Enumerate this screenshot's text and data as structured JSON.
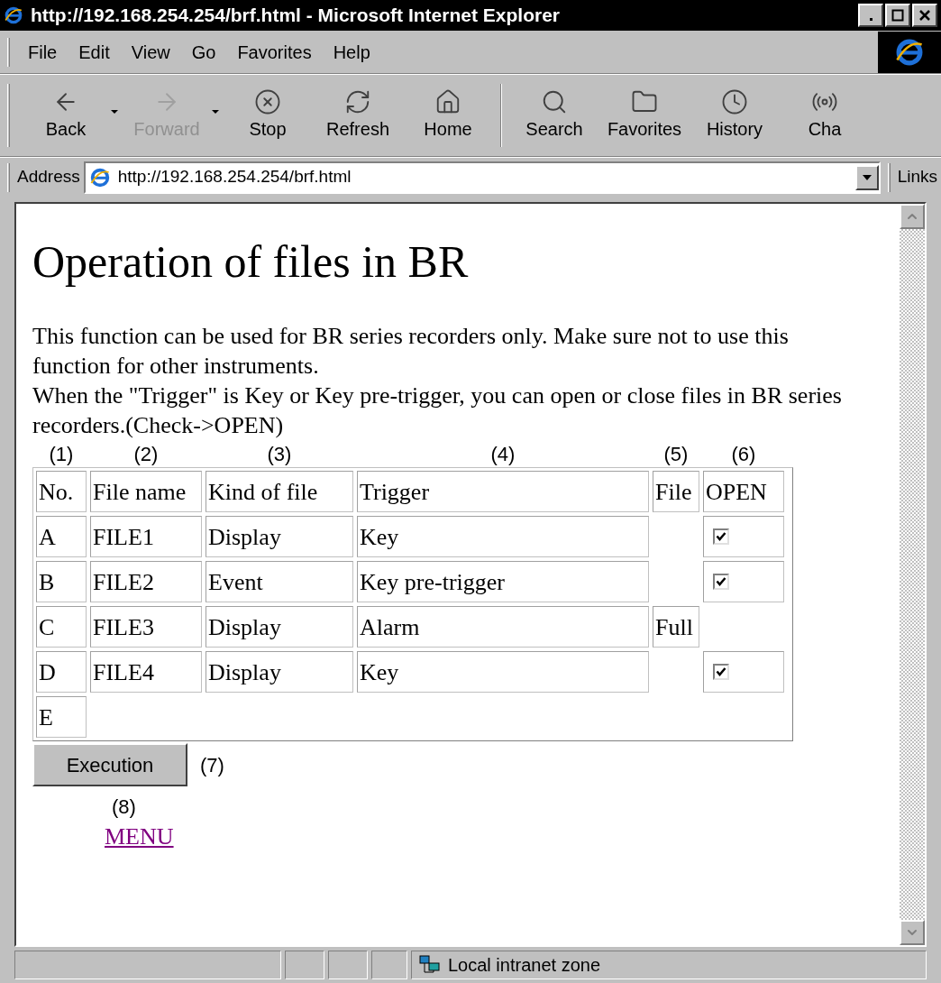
{
  "window": {
    "title": "http://192.168.254.254/brf.html - Microsoft Internet Explorer"
  },
  "menu": [
    "File",
    "Edit",
    "View",
    "Go",
    "Favorites",
    "Help"
  ],
  "toolbar": [
    {
      "kind": "back",
      "label": "Back",
      "disabled": false,
      "dropdown": true
    },
    {
      "kind": "forward",
      "label": "Forward",
      "disabled": true,
      "dropdown": true
    },
    {
      "kind": "stop",
      "label": "Stop",
      "disabled": false,
      "dropdown": false
    },
    {
      "kind": "refresh",
      "label": "Refresh",
      "disabled": false,
      "dropdown": false
    },
    {
      "kind": "home",
      "label": "Home",
      "disabled": false,
      "dropdown": false,
      "separator_after": true
    },
    {
      "kind": "search",
      "label": "Search",
      "disabled": false,
      "dropdown": false
    },
    {
      "kind": "favorites",
      "label": "Favorites",
      "disabled": false,
      "dropdown": false
    },
    {
      "kind": "history",
      "label": "History",
      "disabled": false,
      "dropdown": false
    },
    {
      "kind": "channels",
      "label": "Cha",
      "disabled": false,
      "dropdown": false
    }
  ],
  "address": {
    "label": "Address",
    "value": "http://192.168.254.254/brf.html",
    "links": "Links"
  },
  "page": {
    "heading": "Operation of files in BR",
    "paragraphs": [
      "This function can be used for BR series recorders only. Make sure not to use this function for other instruments.",
      "When the \"Trigger\" is Key or Key pre-trigger, you can open or close files in BR series recorders.(Check->OPEN)"
    ],
    "column_callouts": [
      "(1)",
      "(2)",
      "(3)",
      "(4)",
      "(5)",
      "(6)"
    ],
    "table": {
      "columns": [
        "No.",
        "File name",
        "Kind of file",
        "Trigger",
        "File",
        "OPEN"
      ],
      "rows": [
        {
          "no": "A",
          "file_name": "FILE1",
          "kind_of_file": "Display",
          "trigger": "Key",
          "open": {
            "checked": true
          }
        },
        {
          "no": "B",
          "file_name": "FILE2",
          "kind_of_file": "Event",
          "trigger": "Key pre-trigger",
          "open": {
            "checked": true
          }
        },
        {
          "no": "C",
          "file_name": "FILE3",
          "kind_of_file": "Display",
          "trigger": "Alarm",
          "file": "Full"
        },
        {
          "no": "D",
          "file_name": "FILE4",
          "kind_of_file": "Display",
          "trigger": "Key",
          "open": {
            "checked": true
          }
        },
        {
          "no": "E"
        }
      ]
    },
    "button": {
      "label": "Execution",
      "callout": "(7)"
    },
    "link_callout": "(8)",
    "link": "MENU"
  },
  "status_bar": {
    "zone": "Local intranet zone"
  }
}
